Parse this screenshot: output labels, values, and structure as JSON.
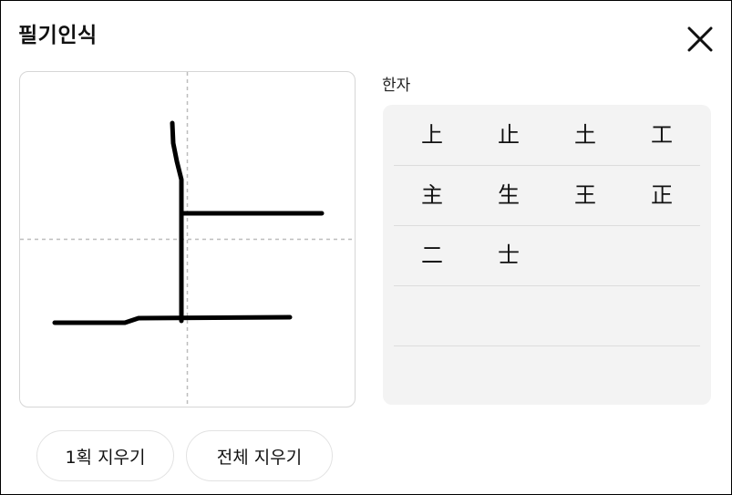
{
  "dialog": {
    "title": "필기인식",
    "close_icon": "close-icon"
  },
  "canvas": {
    "guide_lines": "dashed-cross",
    "stroke_color": "#000000"
  },
  "candidates": {
    "label": "한자",
    "rows": [
      [
        "上",
        "止",
        "土",
        "工"
      ],
      [
        "主",
        "生",
        "王",
        "正"
      ],
      [
        "二",
        "士"
      ],
      [],
      []
    ]
  },
  "buttons": {
    "undo_stroke": "1획 지우기",
    "clear_all": "전체 지우기"
  }
}
